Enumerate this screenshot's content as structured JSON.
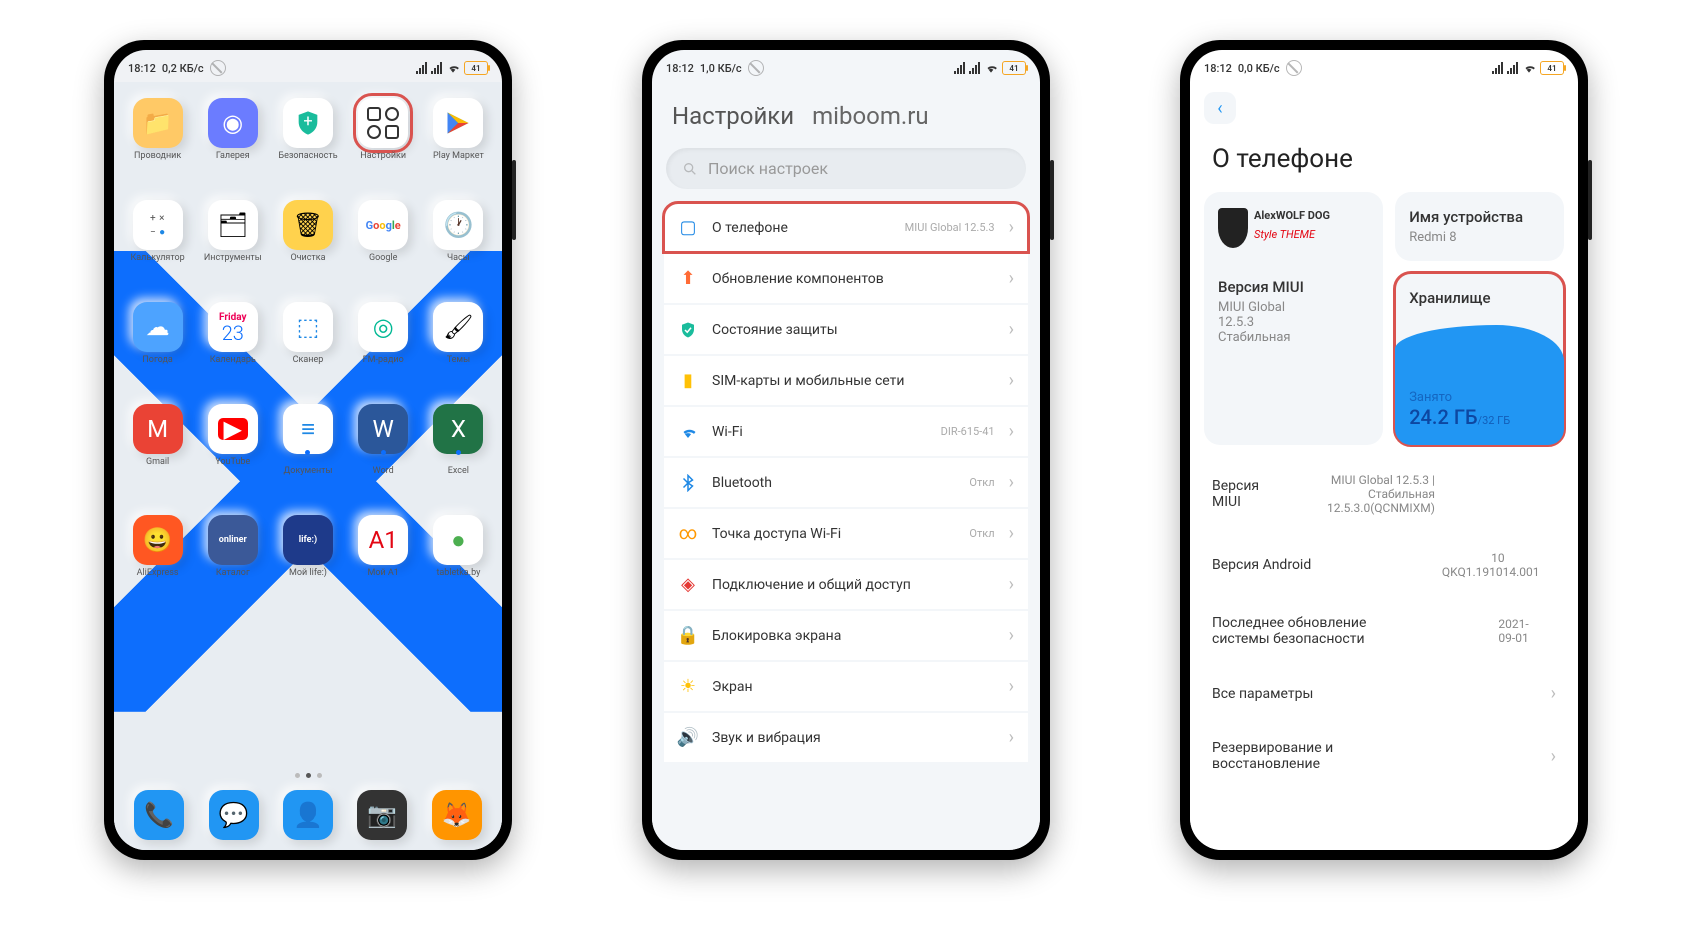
{
  "status": {
    "time": "18:12",
    "speed1": "0,2 КБ/с",
    "speed2": "1,0 КБ/с",
    "speed3": "0,0 КБ/с",
    "battery": "41"
  },
  "home": {
    "apps": [
      {
        "label": "Проводник",
        "icon": "📁",
        "bg": "#ffc966"
      },
      {
        "label": "Галерея",
        "icon": "◉",
        "bg": "#6b7cff",
        "color": "#fff"
      },
      {
        "label": "Безопасность",
        "icon": "✚",
        "bg": "#1abc9c",
        "color": "#fff",
        "shield": true
      },
      {
        "label": "Настройки",
        "icon": "⚙",
        "highlight": true,
        "grid": true
      },
      {
        "label": "Play Маркет",
        "icon": "▶",
        "play": true
      },
      {
        "label": "Калькулятор",
        "icon": "calc"
      },
      {
        "label": "Инструменты",
        "icon": "🗂"
      },
      {
        "label": "Очистка",
        "icon": "🗑",
        "bg": "#ffd24d"
      },
      {
        "label": "Google",
        "icon": "G",
        "google": true
      },
      {
        "label": "Часы",
        "icon": "🕐"
      },
      {
        "label": "Погода",
        "icon": "☁",
        "bg": "#4da3ff",
        "color": "#fff"
      },
      {
        "label": "Календарь",
        "icon": "cal"
      },
      {
        "label": "Сканер",
        "icon": "⬚",
        "bg": "#fff",
        "color": "#1e88e5"
      },
      {
        "label": "FM-радио",
        "icon": "◎",
        "bg": "#fff",
        "color": "#00b894"
      },
      {
        "label": "Темы",
        "icon": "🖌"
      },
      {
        "label": "Gmail",
        "icon": "M",
        "bg": "#ea4335",
        "color": "#fff"
      },
      {
        "label": "YouTube",
        "icon": "▶",
        "bg": "#ff0000",
        "color": "#fff",
        "wrap": true
      },
      {
        "label": "Документы",
        "icon": "≡",
        "bg": "#fff",
        "color": "#1e88e5",
        "dot": true
      },
      {
        "label": "Word",
        "icon": "W",
        "bg": "#2b579a",
        "color": "#fff",
        "dot": true
      },
      {
        "label": "Excel",
        "icon": "X",
        "bg": "#217346",
        "color": "#fff",
        "dot": true
      },
      {
        "label": "AliExpress",
        "icon": "😀",
        "bg": "#ff5722",
        "color": "#fff"
      },
      {
        "label": "Каталог",
        "icon": "onliner",
        "small": true,
        "bg": "#3b5998",
        "color": "#fff"
      },
      {
        "label": "Мой life:)",
        "icon": "life:)",
        "small": true,
        "bg": "#1e3a8a",
        "color": "#fff"
      },
      {
        "label": "Мой A1",
        "icon": "A1",
        "bg": "#fff",
        "color": "#e30613"
      },
      {
        "label": "tabletka.by",
        "icon": "●",
        "bg": "#fff",
        "color": "#4caf50"
      }
    ],
    "dock": [
      {
        "label": "phone",
        "icon": "📞",
        "bg": "#2196f3",
        "color": "#fff"
      },
      {
        "label": "messages",
        "icon": "💬",
        "bg": "#2196f3",
        "color": "#fff"
      },
      {
        "label": "contacts",
        "icon": "👤",
        "bg": "#2196f3",
        "color": "#fff"
      },
      {
        "label": "camera",
        "icon": "📷",
        "bg": "#333",
        "color": "#fff"
      },
      {
        "label": "firefox",
        "icon": "🦊",
        "bg": "#ff9500",
        "color": "#fff"
      }
    ],
    "calendar": {
      "day": "Friday",
      "num": "23"
    }
  },
  "settings": {
    "title": "Настройки",
    "brand": "miboom.ru",
    "search_placeholder": "Поиск настроек",
    "rows": [
      {
        "label": "О телефоне",
        "val": "MIUI Global 12.5.3",
        "icon": "▢",
        "color": "#1e88e5",
        "highlight": true
      },
      {
        "label": "Обновление компонентов",
        "icon": "⬆",
        "color": "#ff6b35"
      },
      {
        "label": "Состояние защиты",
        "icon": "✓",
        "color": "#1abc9c",
        "shield": true
      },
      {
        "label": "SIM-карты и мобильные сети",
        "icon": "▮",
        "color": "#ffc107"
      },
      {
        "label": "Wi-Fi",
        "val": "DIR-615-41",
        "icon": "wifi",
        "color": "#1e88e5"
      },
      {
        "label": "Bluetooth",
        "val": "Откл",
        "icon": "bt",
        "color": "#1e88e5"
      },
      {
        "label": "Точка доступа Wi-Fi",
        "val": "Откл",
        "icon": "∞",
        "color": "#ff9800"
      },
      {
        "label": "Подключение и общий доступ",
        "icon": "◈",
        "color": "#e53935"
      },
      {
        "label": "Блокировка экрана",
        "icon": "🔒",
        "color": "#e53935"
      },
      {
        "label": "Экран",
        "icon": "☀",
        "color": "#ffc107"
      },
      {
        "label": "Звук и вибрация",
        "icon": "🔊",
        "color": "#4caf50"
      }
    ]
  },
  "about": {
    "title": "О телефоне",
    "device_name_label": "Имя устройства",
    "device_name": "Redmi 8",
    "theme_line1": "AlexWOLF DOG",
    "theme_line2": "Style THEME",
    "miui_card_label": "Версия MIUI",
    "miui_card_val1": "MIUI Global",
    "miui_card_val2": "12.5.3",
    "miui_card_val3": "Стабильная",
    "storage_label": "Хранилище",
    "storage_busy_label": "Занято",
    "storage_used": "24.2 ГБ",
    "storage_total": "/32 ГБ",
    "rows": [
      {
        "label": "Версия MIUI",
        "val": "MIUI Global 12.5.3 | Стабильная 12.5.3.0(QCNMIXM)"
      },
      {
        "label": "Версия Android",
        "val": "10 QKQ1.191014.001"
      },
      {
        "label": "Последнее обновление системы безопасности",
        "val": "2021-09-01"
      },
      {
        "label": "Все параметры",
        "link": true
      },
      {
        "label": "Резервирование и восстановление",
        "link": true
      }
    ]
  }
}
